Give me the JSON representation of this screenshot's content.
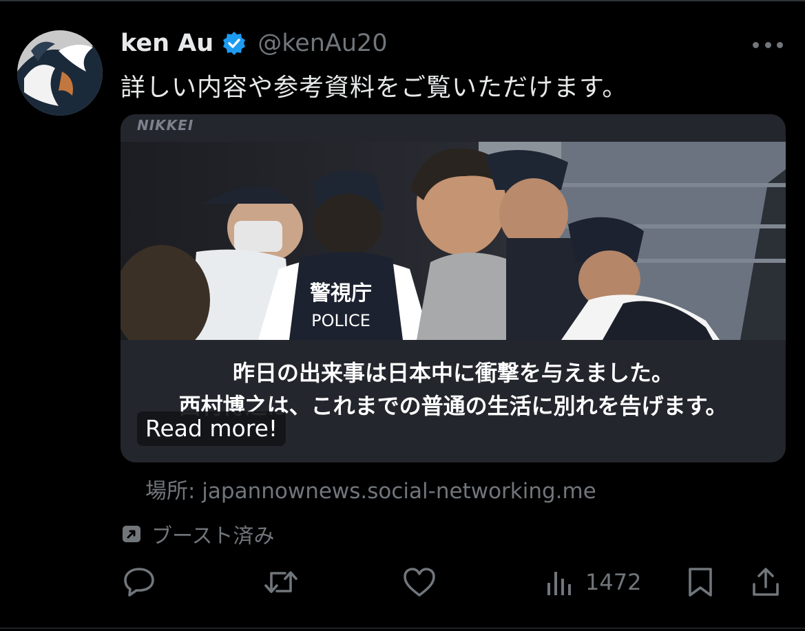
{
  "author": {
    "display_name": "ken Au",
    "handle": "@kenAu20",
    "verified": true
  },
  "tweet": {
    "text": "詳しい内容や参考資料をご覧いただけます。"
  },
  "card": {
    "logo": "NIKKEI",
    "photo_vest_label_jp": "警視庁",
    "photo_vest_label_en": "POLICE",
    "headline_line1": "昨日の出来事は日本中に衝撃を与えました。",
    "headline_line2": "西村博之は、これまでの普通の生活に別れを告げます。",
    "read_more": "Read more!"
  },
  "source": {
    "text": "場所: japannownews.social-networking.me"
  },
  "boost": {
    "label": "ブースト済み"
  },
  "actions": {
    "views": "1472"
  },
  "colors": {
    "background": "#000000",
    "text_primary": "#e7e9ea",
    "text_secondary": "#71767b",
    "card_bg": "#24262d",
    "verified_blue": "#1d9bf0"
  },
  "icons": [
    "more-icon",
    "verified-icon",
    "boost-icon",
    "reply-icon",
    "retweet-icon",
    "like-icon",
    "views-icon",
    "bookmark-icon",
    "share-icon"
  ]
}
